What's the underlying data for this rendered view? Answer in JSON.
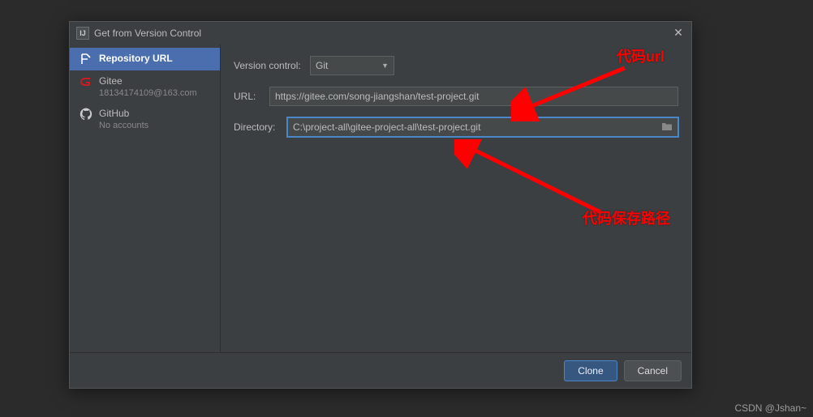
{
  "dialog": {
    "title": "Get from Version Control",
    "app_icon_text": "IJ"
  },
  "sidebar": {
    "items": [
      {
        "label": "Repository URL",
        "sub": ""
      },
      {
        "label": "Gitee",
        "sub": "18134174109@163.com"
      },
      {
        "label": "GitHub",
        "sub": "No accounts"
      }
    ]
  },
  "form": {
    "vcs_label": "Version control:",
    "vcs_value": "Git",
    "url_label": "URL:",
    "url_value": "https://gitee.com/song-jiangshan/test-project.git",
    "dir_label": "Directory:",
    "dir_value": "C:\\project-all\\gitee-project-all\\test-project.git"
  },
  "footer": {
    "clone": "Clone",
    "cancel": "Cancel"
  },
  "annotations": {
    "a1": "代码url",
    "a2": "代码保存路径"
  },
  "watermark": "CSDN @Jshan~"
}
